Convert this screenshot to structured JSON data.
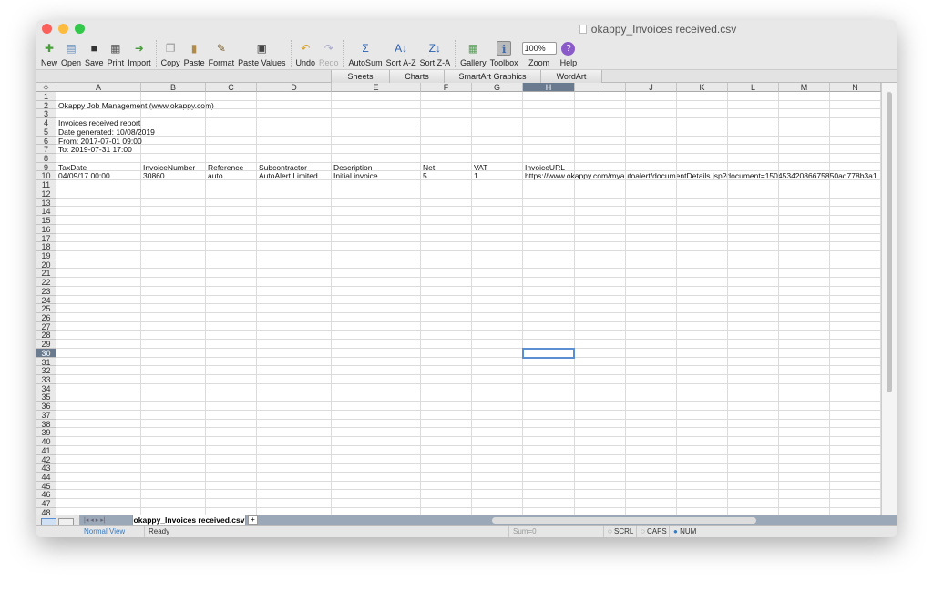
{
  "window": {
    "title": "okappy_Invoices received.csv"
  },
  "toolbar": [
    {
      "label": "New",
      "icon": "new-icon",
      "color": "#4a9d3c"
    },
    {
      "label": "Open",
      "icon": "open-icon",
      "color": "#6b8fb8"
    },
    {
      "label": "Save",
      "icon": "save-icon",
      "color": "#333"
    },
    {
      "label": "Print",
      "icon": "print-icon",
      "color": "#555"
    },
    {
      "label": "Import",
      "icon": "import-icon",
      "color": "#4a9d3c"
    },
    {
      "sep": true
    },
    {
      "label": "Copy",
      "icon": "copy-icon",
      "color": "#999"
    },
    {
      "label": "Paste",
      "icon": "paste-icon",
      "color": "#b08a4a"
    },
    {
      "label": "Format",
      "icon": "format-brush-icon",
      "color": "#7a5a2a"
    },
    {
      "label": "Paste Values",
      "icon": "paste-values-icon",
      "color": "#444"
    },
    {
      "sep": true
    },
    {
      "label": "Undo",
      "icon": "undo-icon",
      "color": "#d9a320"
    },
    {
      "label": "Redo",
      "icon": "redo-icon",
      "color": "#aac",
      "disabled": true
    },
    {
      "sep": true
    },
    {
      "label": "AutoSum",
      "icon": "sigma-icon",
      "color": "#2a5fb0"
    },
    {
      "label": "Sort A-Z",
      "icon": "sort-az-icon",
      "color": "#2a5fb0"
    },
    {
      "label": "Sort Z-A",
      "icon": "sort-za-icon",
      "color": "#2a5fb0"
    },
    {
      "sep": true
    },
    {
      "label": "Gallery",
      "icon": "gallery-icon",
      "color": "#5a9a5a"
    },
    {
      "label": "Toolbox",
      "icon": "toolbox-icon",
      "color": "#3a6ab0"
    },
    {
      "label": "Zoom",
      "icon": "zoom-select",
      "value": "100%"
    },
    {
      "label": "Help",
      "icon": "help-icon",
      "color": "#8a5ac8"
    }
  ],
  "ribbon_tabs": [
    "Sheets",
    "Charts",
    "SmartArt Graphics",
    "WordArt"
  ],
  "columns": [
    "A",
    "B",
    "C",
    "D",
    "E",
    "F",
    "G",
    "H",
    "I",
    "J",
    "K",
    "L",
    "M",
    "N"
  ],
  "row_count": 48,
  "selected_cell": "H30",
  "cells": {
    "2": {
      "A": "Okappy Job Management (www.okappy.com)"
    },
    "4": {
      "A": "Invoices received report"
    },
    "5": {
      "A": "Date generated: 10/08/2019"
    },
    "6": {
      "A": "From: 2017-07-01 09:00"
    },
    "7": {
      "A": "To: 2019-07-31 17:00"
    },
    "9": {
      "A": "TaxDate",
      "B": "InvoiceNumber",
      "C": "Reference",
      "D": "Subcontractor",
      "E": "Description",
      "F": "Net",
      "G": "VAT",
      "H": "InvoiceURL"
    },
    "10": {
      "A": "04/09/17 00:00",
      "B": "30860",
      "C": "auto",
      "D": "AutoAlert Limited",
      "E": "Initial invoice",
      "F": "5",
      "G": "1",
      "H": "https://www.okappy.com/myautoalert/documentDetails.jsp?document=15045342086675850ad778b3a1"
    }
  },
  "sheet_tab": "okappy_Invoices received.csv",
  "status": {
    "view": "Normal View",
    "ready": "Ready",
    "sum": "Sum=0",
    "scrl": "SCRL",
    "caps": "CAPS",
    "num": "NUM"
  }
}
